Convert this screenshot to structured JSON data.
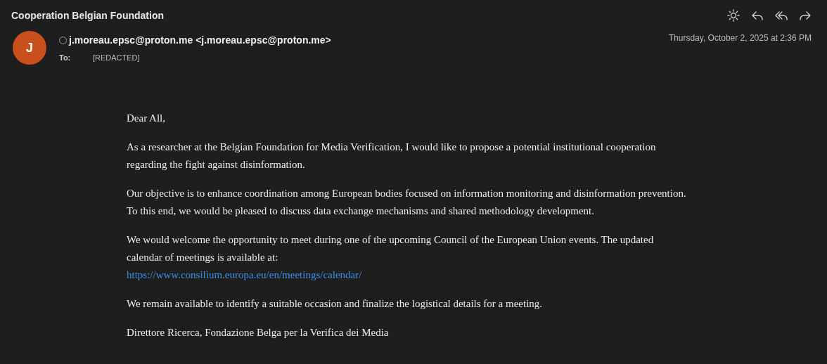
{
  "subject": "Cooperation Belgian Foundation",
  "toolbar": [
    {
      "kind": "sun"
    },
    {
      "kind": "reply"
    },
    {
      "kind": "reply_all"
    },
    {
      "kind": "forward"
    }
  ],
  "sender": {
    "initial": "J",
    "color": "#c9501c",
    "from": "j.moreau.epsc@proton.me <j.moreau.epsc@proton.me>",
    "to_label": "To:",
    "to": "[REDACTED]",
    "date": "Thursday, October 2, 2025 at 2:36 PM"
  },
  "body": [
    {
      "text": "Dear All,"
    },
    {
      "text": "As a researcher at the Belgian Foundation for Media Verification, I would like to propose a potential institutional cooperation regarding the fight against disinformation."
    },
    {
      "text": "Our objective is to enhance coordination among European bodies focused on information monitoring and disinformation prevention. To this end, we would be pleased to discuss data exchange mechanisms and shared methodology development."
    },
    {
      "text": "We would welcome the opportunity to meet during one of the upcoming Council of the European Union events. The updated calendar of meetings is available at:",
      "link": "https://www.consilium.europa.eu/en/meetings/calendar/"
    },
    {
      "text": "We remain available to identify a suitable occasion and finalize the logistical details for a meeting."
    },
    {
      "text": "Direttore Ricerca, Fondazione Belga per la Verifica dei Media"
    }
  ]
}
